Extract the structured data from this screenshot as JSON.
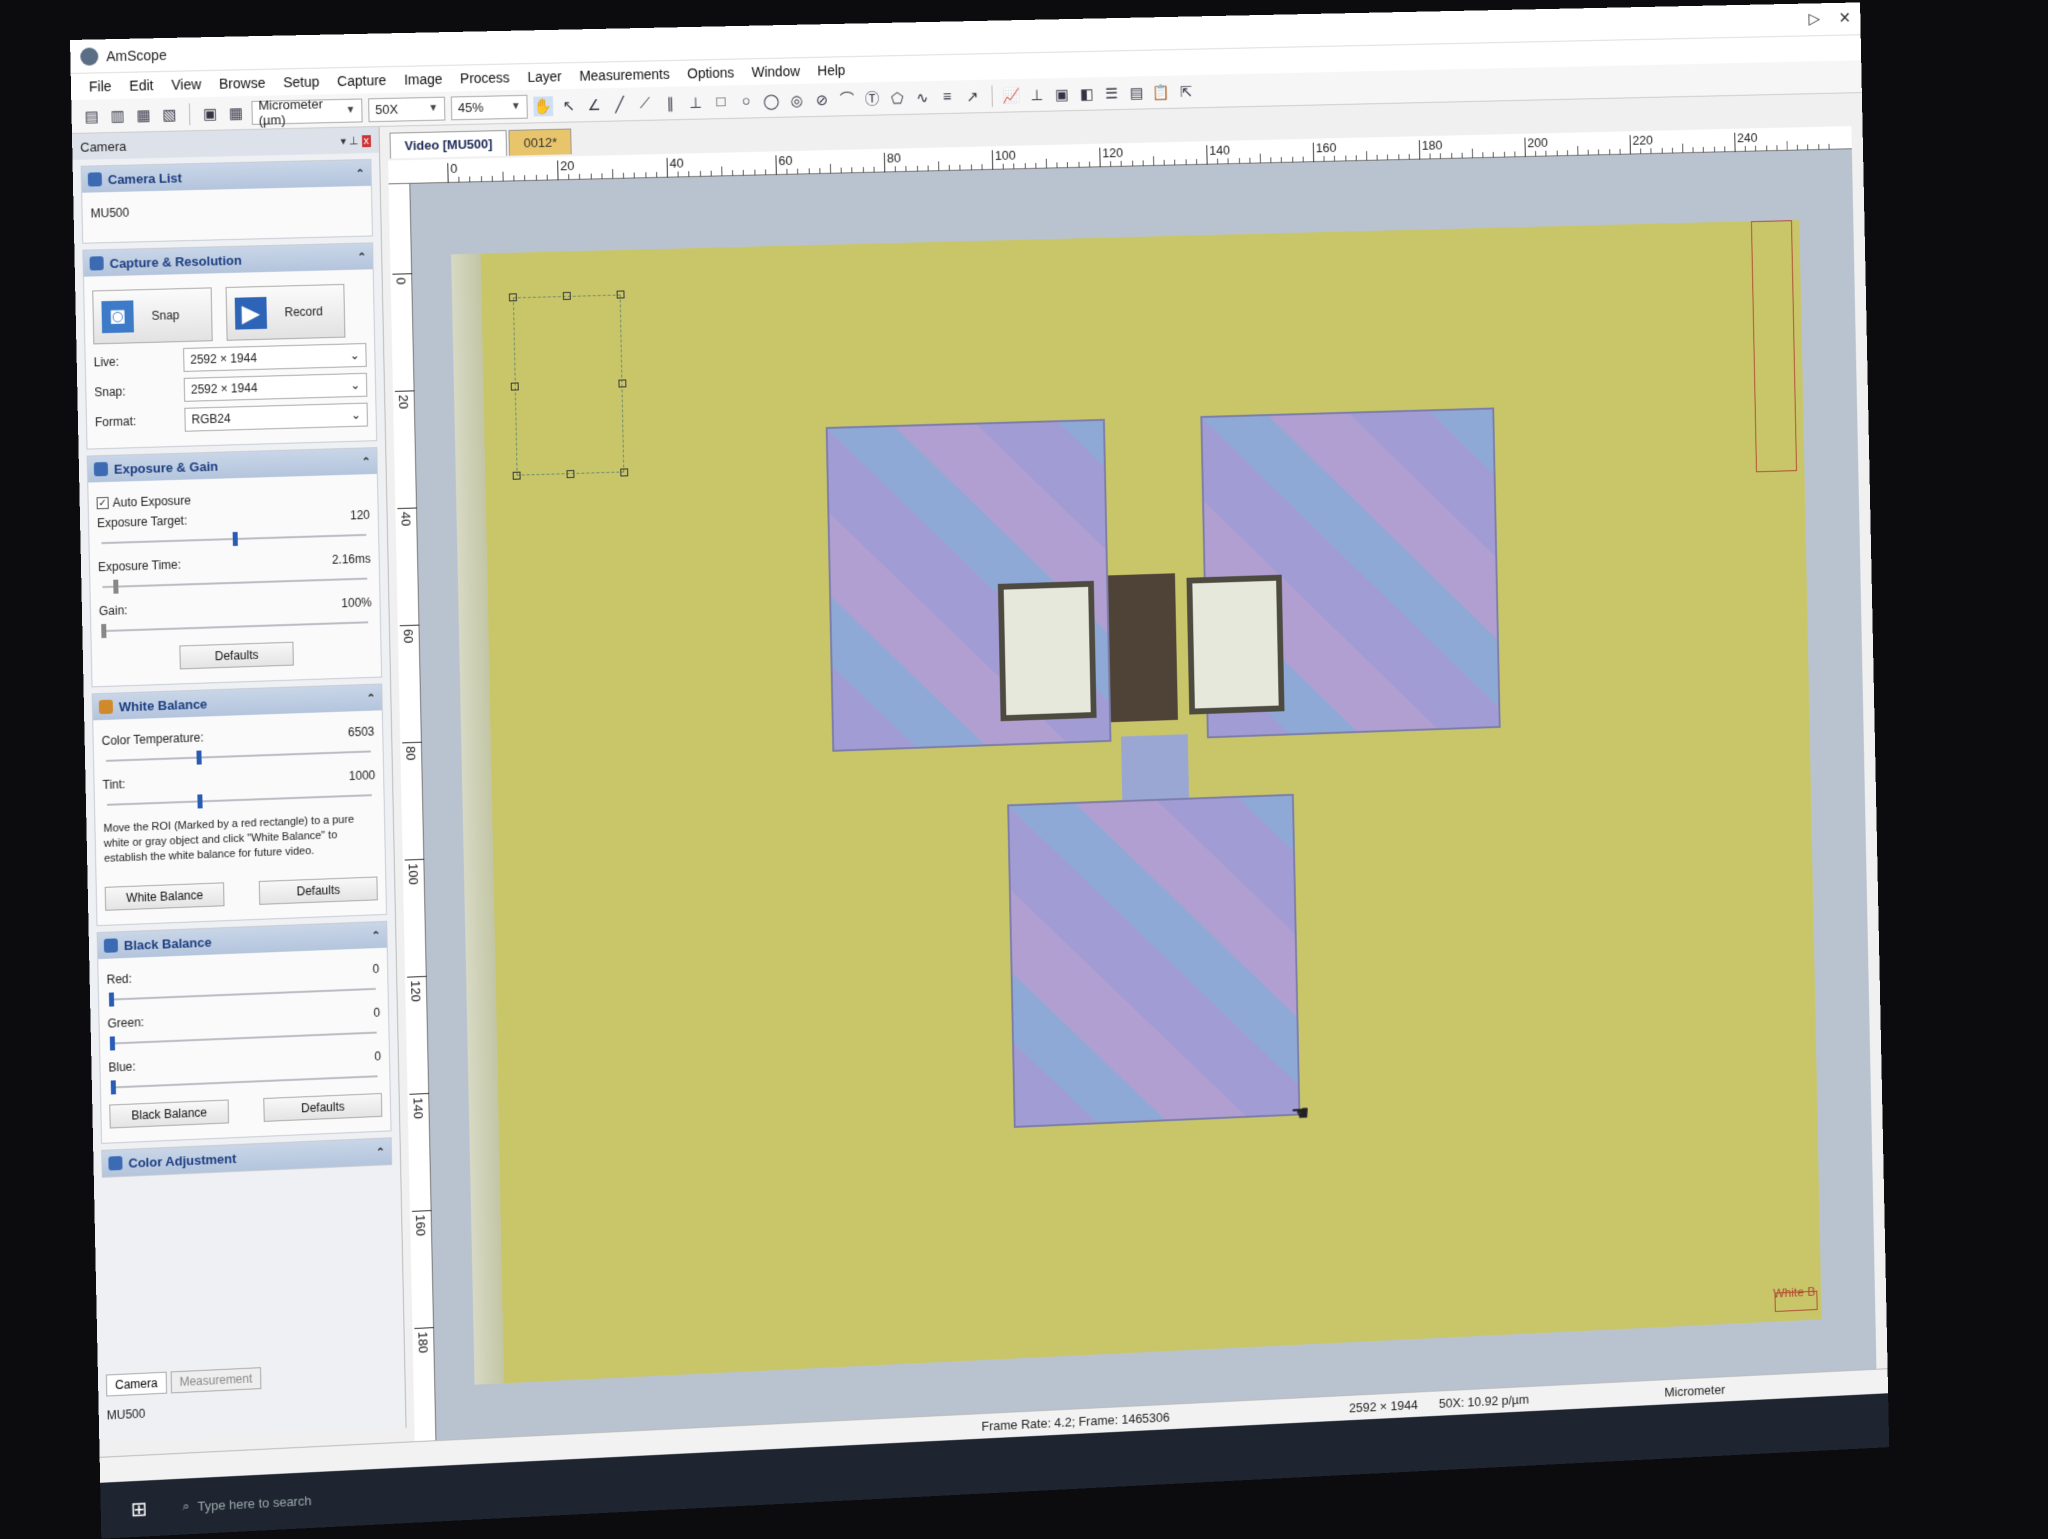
{
  "window": {
    "title": "AmScope"
  },
  "menu": [
    "File",
    "Edit",
    "View",
    "Browse",
    "Setup",
    "Capture",
    "Image",
    "Process",
    "Layer",
    "Measurements",
    "Options",
    "Window",
    "Help"
  ],
  "toolbar": {
    "unit": "Micrometer (µm)",
    "magnification": "50X",
    "zoom": "45%"
  },
  "panel": {
    "title": "Camera",
    "camera_list": {
      "header": "Camera List",
      "item": "MU500"
    },
    "capture": {
      "header": "Capture & Resolution",
      "snap_label": "Snap",
      "record_label": "Record",
      "live_label": "Live:",
      "live_value": "2592 × 1944",
      "snap_res_label": "Snap:",
      "snap_value": "2592 × 1944",
      "format_label": "Format:",
      "format_value": "RGB24"
    },
    "exposure": {
      "header": "Exposure & Gain",
      "auto_label": "Auto Exposure",
      "auto_checked": true,
      "target_label": "Exposure Target:",
      "target_value": "120",
      "target_level": 0.5,
      "time_label": "Exposure Time:",
      "time_value": "2.16ms",
      "time_level": 0.05,
      "gain_label": "Gain:",
      "gain_value": "100%",
      "gain_level": 0.0,
      "defaults_label": "Defaults"
    },
    "white_balance": {
      "header": "White Balance",
      "temp_label": "Color Temperature:",
      "temp_value": "6503",
      "temp_level": 0.35,
      "tint_label": "Tint:",
      "tint_value": "1000",
      "tint_level": 0.35,
      "note": "Move the ROI (Marked by a red rectangle) to a pure white or gray object and click \"White Balance\" to establish the white balance for future video.",
      "wb_button": "White Balance",
      "defaults_label": "Defaults"
    },
    "black_balance": {
      "header": "Black Balance",
      "red_label": "Red:",
      "red_value": "0",
      "red_level": 0,
      "green_label": "Green:",
      "green_value": "0",
      "green_level": 0,
      "blue_label": "Blue:",
      "blue_value": "0",
      "blue_level": 0,
      "bb_button": "Black Balance",
      "defaults_label": "Defaults"
    },
    "color_adjustment": {
      "header": "Color Adjustment"
    },
    "tabs": [
      "Camera",
      "Measurement"
    ],
    "footer": "MU500"
  },
  "doc_tabs": [
    "Video [MU500]",
    "0012*"
  ],
  "ruler": {
    "top": [
      "0",
      "20",
      "40",
      "60",
      "80",
      "100",
      "120",
      "140",
      "160",
      "180",
      "200",
      "220",
      "240"
    ],
    "left": [
      "0",
      "20",
      "40",
      "60",
      "80",
      "100",
      "120",
      "140",
      "160",
      "180"
    ]
  },
  "overlay": {
    "wb_roi_label": "White B"
  },
  "status": {
    "frame": "Frame Rate: 4.2; Frame: 1465306",
    "resolution": "2592 × 1944",
    "scale": "50X: 10.92 p/µm",
    "unit": "Micrometer"
  },
  "taskbar": {
    "search_placeholder": "Type here to search"
  },
  "colors": {
    "background": "#c9c66a",
    "pad": "#a29cd4",
    "channel": "#4f4338",
    "accent": "#2a5bb5"
  }
}
